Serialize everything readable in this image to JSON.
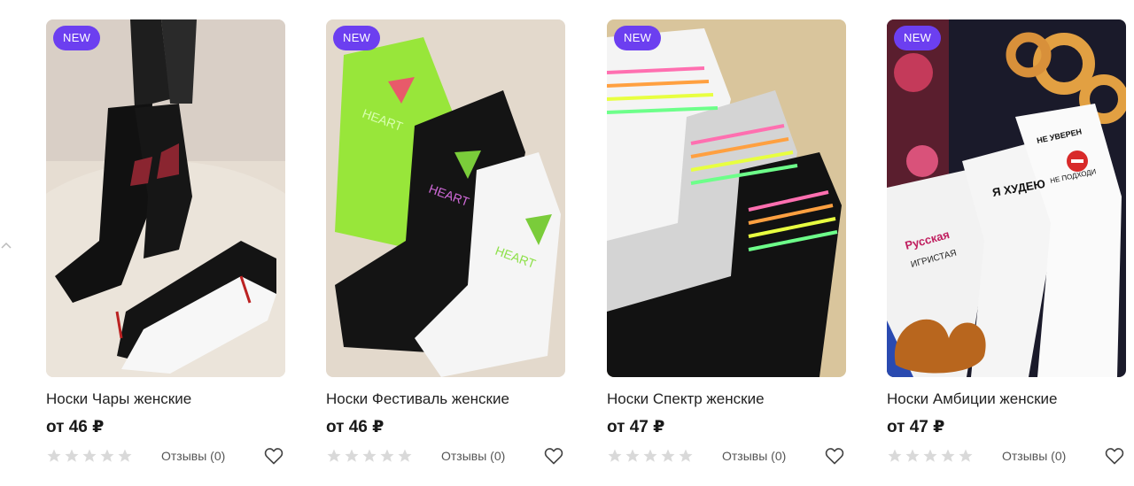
{
  "colors": {
    "badge": "#6c3ff0",
    "star_empty": "#d9d9d9"
  },
  "nav": {
    "prev_icon": "chevron-left-icon"
  },
  "products": [
    {
      "badge": "NEW",
      "title": "Носки Чары женские",
      "price": "от 46 ₽",
      "rating": 0,
      "reviews": "Отзывы (0)"
    },
    {
      "badge": "NEW",
      "title": "Носки Фестиваль женские",
      "price": "от 46 ₽",
      "rating": 0,
      "reviews": "Отзывы (0)"
    },
    {
      "badge": "NEW",
      "title": "Носки Спектр женские",
      "price": "от 47 ₽",
      "rating": 0,
      "reviews": "Отзывы (0)"
    },
    {
      "badge": "NEW",
      "title": "Носки Амбиции женские",
      "price": "от 47 ₽",
      "rating": 0,
      "reviews": "Отзывы (0)"
    }
  ]
}
